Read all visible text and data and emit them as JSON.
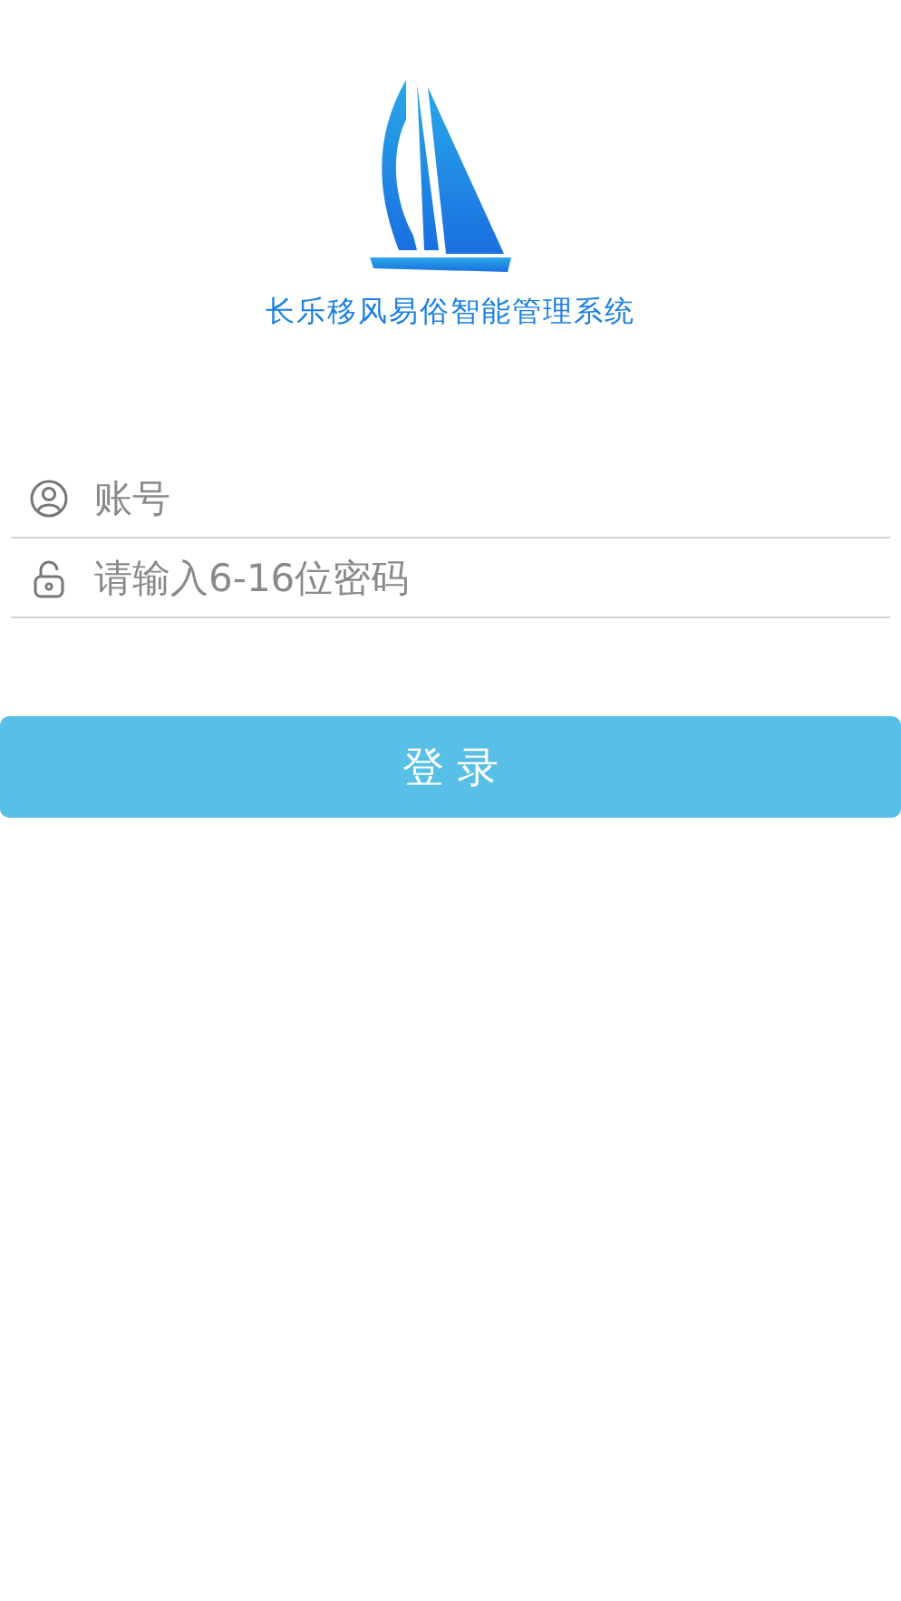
{
  "logo": {
    "caption": "长乐移风易俗智能管理系统"
  },
  "fields": [
    {
      "kind": "user",
      "placeholder": "账号"
    },
    {
      "kind": "password",
      "placeholder": "请输入6-16位密码"
    }
  ],
  "login_button": {
    "label": "登 录"
  }
}
